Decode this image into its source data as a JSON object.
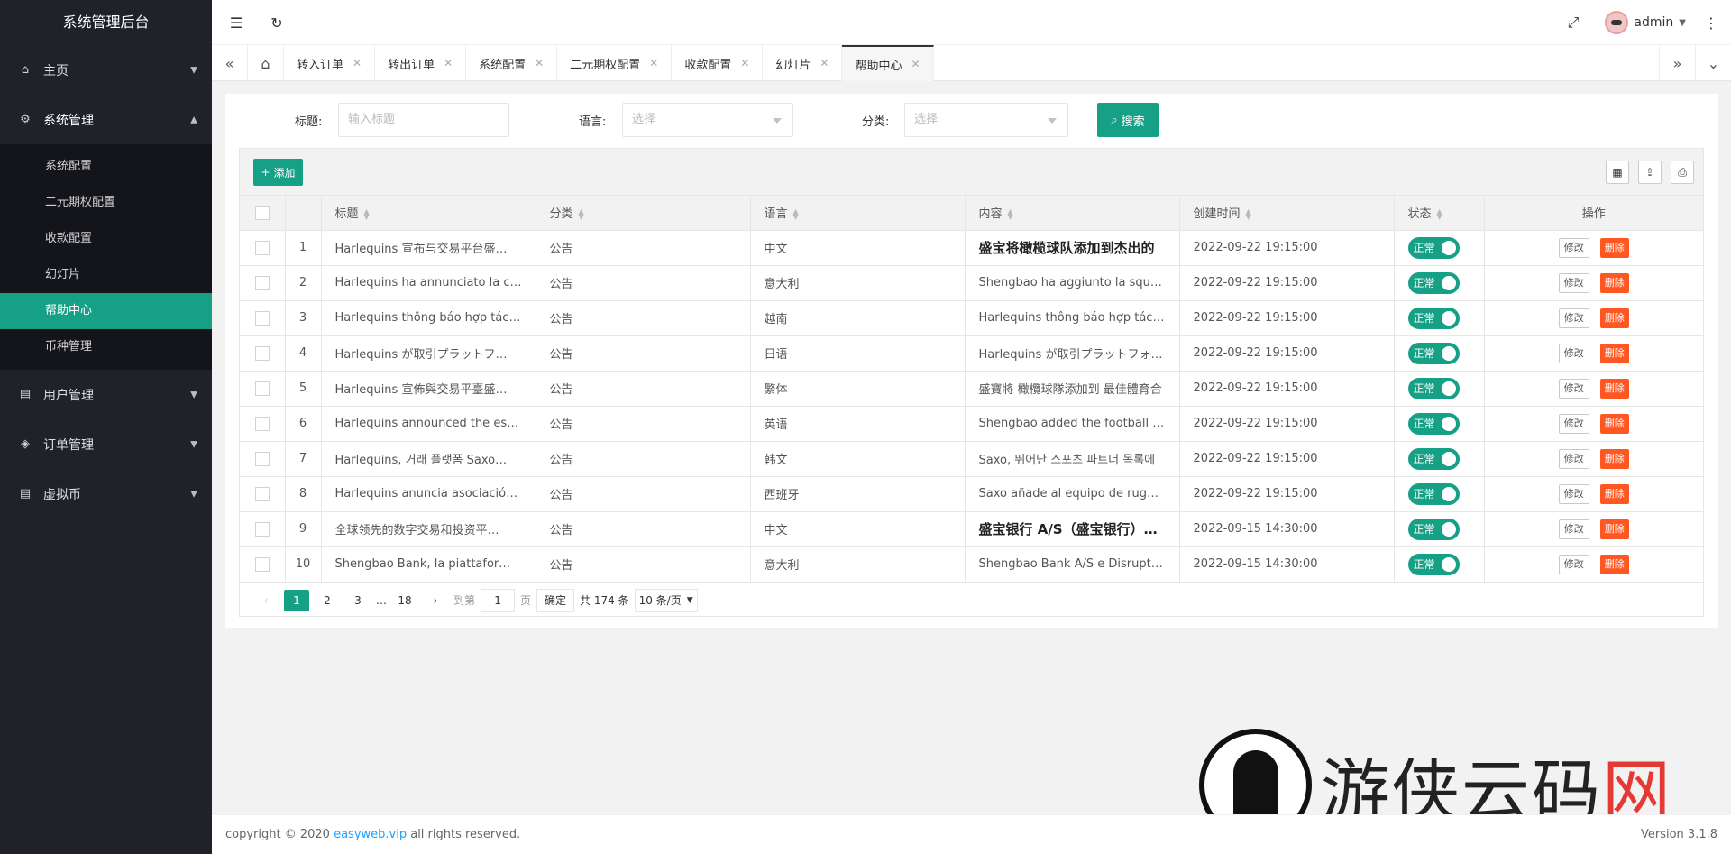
{
  "app": {
    "title": "系统管理后台"
  },
  "sidebar": {
    "items": [
      {
        "label": "主页",
        "icon": "home-icon"
      },
      {
        "label": "系统管理",
        "icon": "gear-icon"
      },
      {
        "label": "用户管理",
        "icon": "user-icon"
      },
      {
        "label": "订单管理",
        "icon": "order-icon"
      },
      {
        "label": "虚拟币",
        "icon": "coin-icon"
      }
    ],
    "submenu": [
      "系统配置",
      "二元期权配置",
      "收款配置",
      "幻灯片",
      "帮助中心",
      "币种管理"
    ]
  },
  "header": {
    "user": "admin"
  },
  "tabs": [
    "转入订单",
    "转出订单",
    "系统配置",
    "二元期权配置",
    "收款配置",
    "幻灯片",
    "帮助中心"
  ],
  "filter": {
    "title_label": "标题:",
    "title_placeholder": "输入标题",
    "lang_label": "语言:",
    "lang_placeholder": "选择",
    "cat_label": "分类:",
    "cat_placeholder": "选择",
    "search_label": "搜索"
  },
  "toolbar": {
    "add_label": "添加"
  },
  "table": {
    "headers": [
      "标题",
      "分类",
      "语言",
      "内容",
      "创建时间",
      "状态",
      "操作"
    ],
    "rows": [
      {
        "no": "1",
        "title": "Harlequins 宣布与交易平台盛…",
        "cat": "公告",
        "lang": "中文",
        "content": "盛宝将橄榄球队添加到杰出的",
        "time": "2022-09-22 19:15:00",
        "bold": true
      },
      {
        "no": "2",
        "title": "Harlequins ha annunciato la co…",
        "cat": "公告",
        "lang": "意大利",
        "content": "Shengbao ha aggiunto la squadra d",
        "time": "2022-09-22 19:15:00",
        "bold": false
      },
      {
        "no": "3",
        "title": "Harlequins thông báo hợp tác …",
        "cat": "公告",
        "lang": "越南",
        "content": "Harlequins thông báo hợp tác với sà",
        "time": "2022-09-22 19:15:00",
        "bold": false
      },
      {
        "no": "4",
        "title": "Harlequins が取引プラットフ…",
        "cat": "公告",
        "lang": "日语",
        "content": "Harlequins が取引プラットフォーム",
        "time": "2022-09-22 19:15:00",
        "bold": false
      },
      {
        "no": "5",
        "title": "Harlequins 宣佈與交易平臺盛…",
        "cat": "公告",
        "lang": "繁体",
        "content": "盛寶將 橄欖球隊添加到 最佳體育合",
        "time": "2022-09-22 19:15:00",
        "bold": false
      },
      {
        "no": "6",
        "title": "Harlequins announced the est…",
        "cat": "公告",
        "lang": "英语",
        "content": "Shengbao added the football team t",
        "time": "2022-09-22 19:15:00",
        "bold": false
      },
      {
        "no": "7",
        "title": "Harlequins, 거래 플랫폼 Saxo…",
        "cat": "公告",
        "lang": "韩文",
        "content": "Saxo, 뛰어난 스포츠 파트너 목록에",
        "time": "2022-09-22 19:15:00",
        "bold": false
      },
      {
        "no": "8",
        "title": "Harlequins anuncia asociación…",
        "cat": "公告",
        "lang": "西班牙",
        "content": "Saxo añade al equipo de rugby a la",
        "time": "2022-09-22 19:15:00",
        "bold": false
      },
      {
        "no": "9",
        "title": "全球领先的数字交易和投资平…",
        "cat": "公告",
        "lang": "中文",
        "content": "盛宝银行 A/S（盛宝银行）和 Disru",
        "time": "2022-09-15 14:30:00",
        "bold": true
      },
      {
        "no": "10",
        "title": "Shengbao Bank, la piattaforma…",
        "cat": "公告",
        "lang": "意大利",
        "content": "Shengbao Bank A/S e Disruptive Ca",
        "time": "2022-09-15 14:30:00",
        "bold": false
      }
    ],
    "status_label": "正常",
    "edit_label": "修改",
    "delete_label": "删除"
  },
  "pager": {
    "pages": [
      "1",
      "2",
      "3",
      "…",
      "18"
    ],
    "goto_label": "到第",
    "goto_value": "1",
    "page_label": "页",
    "confirm_label": "确定",
    "total_label": "共 174 条",
    "size_label": "10 条/页"
  },
  "footer": {
    "copy_prefix": "copyright © 2020 ",
    "copy_link": "easyweb.vip",
    "copy_suffix": " all rights reserved.",
    "version": "Version 3.1.8"
  },
  "watermark": {
    "text_a": "游侠云码",
    "text_b": "网"
  },
  "colors": {
    "sidebar": "#20222a",
    "accent": "#16a085",
    "danger": "#ff5722"
  }
}
